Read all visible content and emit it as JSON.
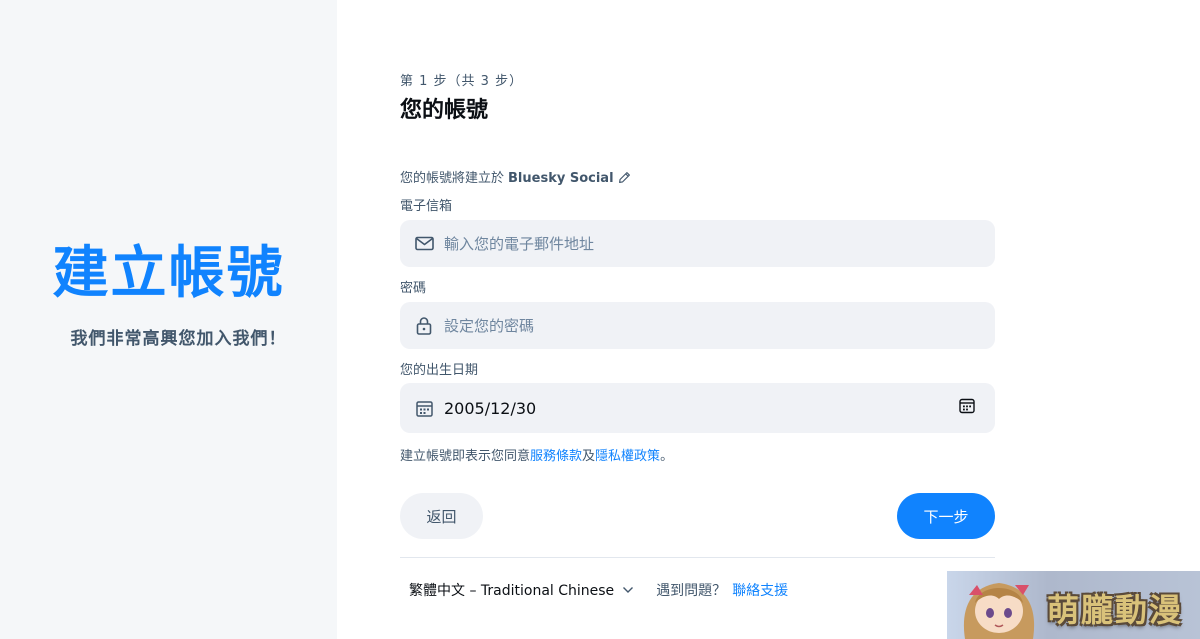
{
  "hero": {
    "title": "建立帳號",
    "subtitle": "我們非常高興您加入我們！"
  },
  "form": {
    "step": "第 1 步（共 3 步）",
    "heading": "您的帳號",
    "hosting_prefix": "您的帳號將建立於",
    "hosting_provider": "Bluesky Social",
    "email": {
      "label": "電子信箱",
      "placeholder": "輸入您的電子郵件地址",
      "icon": "envelope-icon"
    },
    "password": {
      "label": "密碼",
      "placeholder": "設定您的密碼",
      "icon": "lock-icon"
    },
    "birthdate": {
      "label": "您的出生日期",
      "value": "2005/12/30",
      "icon": "calendar-icon"
    },
    "terms": {
      "prefix": "建立帳號即表示您同意",
      "tos_link": "服務條款",
      "middle": "及",
      "privacy_link": "隱私權政策",
      "suffix": "。"
    },
    "back_label": "返回",
    "next_label": "下一步"
  },
  "footer": {
    "language": "繁體中文 – Traditional Chinese",
    "help_text": "遇到問題？",
    "support_link": "聯絡支援"
  },
  "watermark": {
    "text": "萌朧動漫"
  },
  "colors": {
    "accent": "#1083fe",
    "muted_text": "#42576c",
    "field_bg": "#f0f2f6",
    "left_panel_bg": "#f5f7f9"
  }
}
